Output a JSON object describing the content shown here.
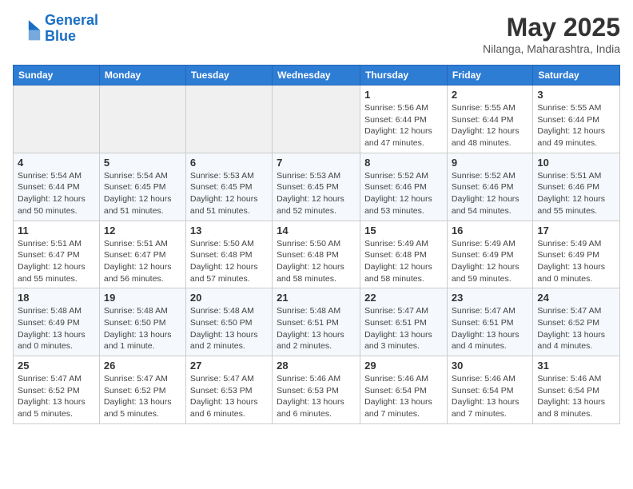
{
  "header": {
    "logo_line1": "General",
    "logo_line2": "Blue",
    "month_year": "May 2025",
    "location": "Nilanga, Maharashtra, India"
  },
  "weekdays": [
    "Sunday",
    "Monday",
    "Tuesday",
    "Wednesday",
    "Thursday",
    "Friday",
    "Saturday"
  ],
  "weeks": [
    [
      {
        "day": "",
        "info": ""
      },
      {
        "day": "",
        "info": ""
      },
      {
        "day": "",
        "info": ""
      },
      {
        "day": "",
        "info": ""
      },
      {
        "day": "1",
        "info": "Sunrise: 5:56 AM\nSunset: 6:44 PM\nDaylight: 12 hours\nand 47 minutes."
      },
      {
        "day": "2",
        "info": "Sunrise: 5:55 AM\nSunset: 6:44 PM\nDaylight: 12 hours\nand 48 minutes."
      },
      {
        "day": "3",
        "info": "Sunrise: 5:55 AM\nSunset: 6:44 PM\nDaylight: 12 hours\nand 49 minutes."
      }
    ],
    [
      {
        "day": "4",
        "info": "Sunrise: 5:54 AM\nSunset: 6:44 PM\nDaylight: 12 hours\nand 50 minutes."
      },
      {
        "day": "5",
        "info": "Sunrise: 5:54 AM\nSunset: 6:45 PM\nDaylight: 12 hours\nand 51 minutes."
      },
      {
        "day": "6",
        "info": "Sunrise: 5:53 AM\nSunset: 6:45 PM\nDaylight: 12 hours\nand 51 minutes."
      },
      {
        "day": "7",
        "info": "Sunrise: 5:53 AM\nSunset: 6:45 PM\nDaylight: 12 hours\nand 52 minutes."
      },
      {
        "day": "8",
        "info": "Sunrise: 5:52 AM\nSunset: 6:46 PM\nDaylight: 12 hours\nand 53 minutes."
      },
      {
        "day": "9",
        "info": "Sunrise: 5:52 AM\nSunset: 6:46 PM\nDaylight: 12 hours\nand 54 minutes."
      },
      {
        "day": "10",
        "info": "Sunrise: 5:51 AM\nSunset: 6:46 PM\nDaylight: 12 hours\nand 55 minutes."
      }
    ],
    [
      {
        "day": "11",
        "info": "Sunrise: 5:51 AM\nSunset: 6:47 PM\nDaylight: 12 hours\nand 55 minutes."
      },
      {
        "day": "12",
        "info": "Sunrise: 5:51 AM\nSunset: 6:47 PM\nDaylight: 12 hours\nand 56 minutes."
      },
      {
        "day": "13",
        "info": "Sunrise: 5:50 AM\nSunset: 6:48 PM\nDaylight: 12 hours\nand 57 minutes."
      },
      {
        "day": "14",
        "info": "Sunrise: 5:50 AM\nSunset: 6:48 PM\nDaylight: 12 hours\nand 58 minutes."
      },
      {
        "day": "15",
        "info": "Sunrise: 5:49 AM\nSunset: 6:48 PM\nDaylight: 12 hours\nand 58 minutes."
      },
      {
        "day": "16",
        "info": "Sunrise: 5:49 AM\nSunset: 6:49 PM\nDaylight: 12 hours\nand 59 minutes."
      },
      {
        "day": "17",
        "info": "Sunrise: 5:49 AM\nSunset: 6:49 PM\nDaylight: 13 hours\nand 0 minutes."
      }
    ],
    [
      {
        "day": "18",
        "info": "Sunrise: 5:48 AM\nSunset: 6:49 PM\nDaylight: 13 hours\nand 0 minutes."
      },
      {
        "day": "19",
        "info": "Sunrise: 5:48 AM\nSunset: 6:50 PM\nDaylight: 13 hours\nand 1 minute."
      },
      {
        "day": "20",
        "info": "Sunrise: 5:48 AM\nSunset: 6:50 PM\nDaylight: 13 hours\nand 2 minutes."
      },
      {
        "day": "21",
        "info": "Sunrise: 5:48 AM\nSunset: 6:51 PM\nDaylight: 13 hours\nand 2 minutes."
      },
      {
        "day": "22",
        "info": "Sunrise: 5:47 AM\nSunset: 6:51 PM\nDaylight: 13 hours\nand 3 minutes."
      },
      {
        "day": "23",
        "info": "Sunrise: 5:47 AM\nSunset: 6:51 PM\nDaylight: 13 hours\nand 4 minutes."
      },
      {
        "day": "24",
        "info": "Sunrise: 5:47 AM\nSunset: 6:52 PM\nDaylight: 13 hours\nand 4 minutes."
      }
    ],
    [
      {
        "day": "25",
        "info": "Sunrise: 5:47 AM\nSunset: 6:52 PM\nDaylight: 13 hours\nand 5 minutes."
      },
      {
        "day": "26",
        "info": "Sunrise: 5:47 AM\nSunset: 6:52 PM\nDaylight: 13 hours\nand 5 minutes."
      },
      {
        "day": "27",
        "info": "Sunrise: 5:47 AM\nSunset: 6:53 PM\nDaylight: 13 hours\nand 6 minutes."
      },
      {
        "day": "28",
        "info": "Sunrise: 5:46 AM\nSunset: 6:53 PM\nDaylight: 13 hours\nand 6 minutes."
      },
      {
        "day": "29",
        "info": "Sunrise: 5:46 AM\nSunset: 6:54 PM\nDaylight: 13 hours\nand 7 minutes."
      },
      {
        "day": "30",
        "info": "Sunrise: 5:46 AM\nSunset: 6:54 PM\nDaylight: 13 hours\nand 7 minutes."
      },
      {
        "day": "31",
        "info": "Sunrise: 5:46 AM\nSunset: 6:54 PM\nDaylight: 13 hours\nand 8 minutes."
      }
    ]
  ]
}
